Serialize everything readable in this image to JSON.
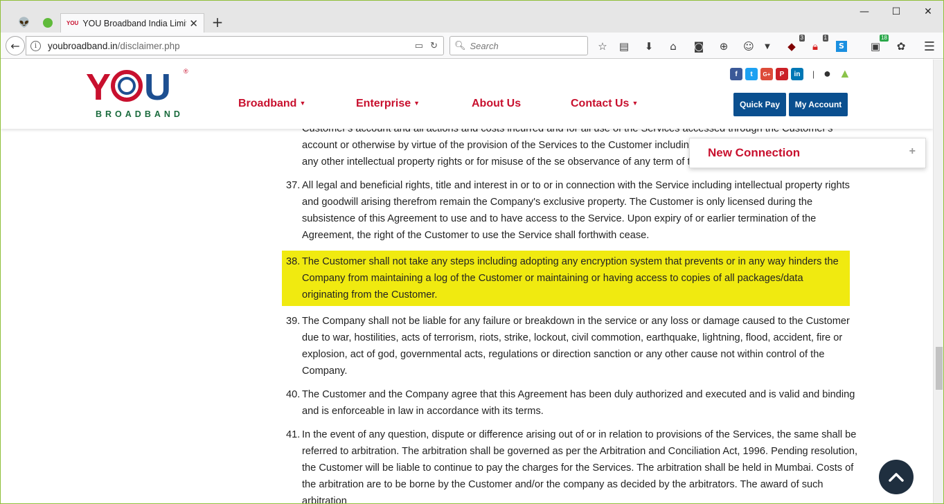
{
  "browser": {
    "tab_title": "YOU Broadband India Limite",
    "tab_favicon": "YOU",
    "url_host": "youbroadband.in",
    "url_path": "/disclaimer.php",
    "search_placeholder": "Search",
    "badges": {
      "ublock": "3",
      "lock": "1",
      "ext": "18"
    }
  },
  "site": {
    "logo_text": "YOU",
    "logo_sub": "BROADBAND",
    "logo_reg": "®",
    "menu": [
      {
        "label": "Broadband",
        "has_dropdown": true
      },
      {
        "label": "Enterprise",
        "has_dropdown": true
      },
      {
        "label": "About Us",
        "has_dropdown": false
      },
      {
        "label": "Contact Us",
        "has_dropdown": true
      }
    ],
    "social": [
      "f",
      "t",
      "G+",
      "P",
      "in"
    ],
    "separator": "|",
    "buttons": {
      "quick_pay": "Quick Pay",
      "my_account": "My Account"
    },
    "colors": {
      "brand_red": "#c8102e",
      "brand_blue": "#0a4f8f",
      "highlight": "#f0ea10"
    }
  },
  "popup": {
    "title": "New Connection",
    "toggle": "+"
  },
  "content": {
    "partial": "Customer's account and all actions and costs incurred and for all use of the Services accessed through the Customer's account or otherwise by virtue of the provision of the Services to the Customer including but not infringement of copyright or any other intellectual property rights or for misuse of the se observance of any term of this Agreement by the Customer.",
    "items": [
      {
        "num": "37.",
        "text": "All legal and beneficial rights, title and interest in or to or in connection with the Service including intellectual property rights and goodwill arising therefrom remain the Company's exclusive property. The Customer is only licensed during the subsistence of this Agreement to use and to have access to the Service. Upon expiry of or earlier termination of the Agreement, the right of the Customer to use the Service shall forthwith cease."
      },
      {
        "num": "38.",
        "text": "The Customer shall not take any steps including adopting any encryption system that prevents or in any way hinders the Company from maintaining a log of the Customer or maintaining or having access to copies of all packages/data originating from the Customer."
      },
      {
        "num": "39.",
        "text": "The Company shall not be liable for any failure or breakdown in the service or any loss or damage caused to the Customer due to war, hostilities, acts of terrorism, riots, strike, lockout, civil commotion, earthquake, lightning, flood, accident, fire or explosion, act of god, governmental acts, regulations or direction sanction or any other cause not within control of the Company."
      },
      {
        "num": "40.",
        "text": "The Customer and the Company agree that this Agreement has been duly authorized and executed and is valid and binding and is enforceable in law in accordance with its terms."
      },
      {
        "num": "41.",
        "text": "In the event of any question, dispute or difference arising out of or in relation to provisions of the Services, the same shall be referred to arbitration. The arbitration shall be governed as per the Arbitration and Conciliation Act, 1996. Pending resolution, the Customer will be liable to continue to pay the charges for the Services. The arbitration shall be held in Mumbai. Costs of the arbitration are to be borne by the Customer and/or the company as decided by the arbitrators. The award of such arbitration"
      }
    ]
  }
}
